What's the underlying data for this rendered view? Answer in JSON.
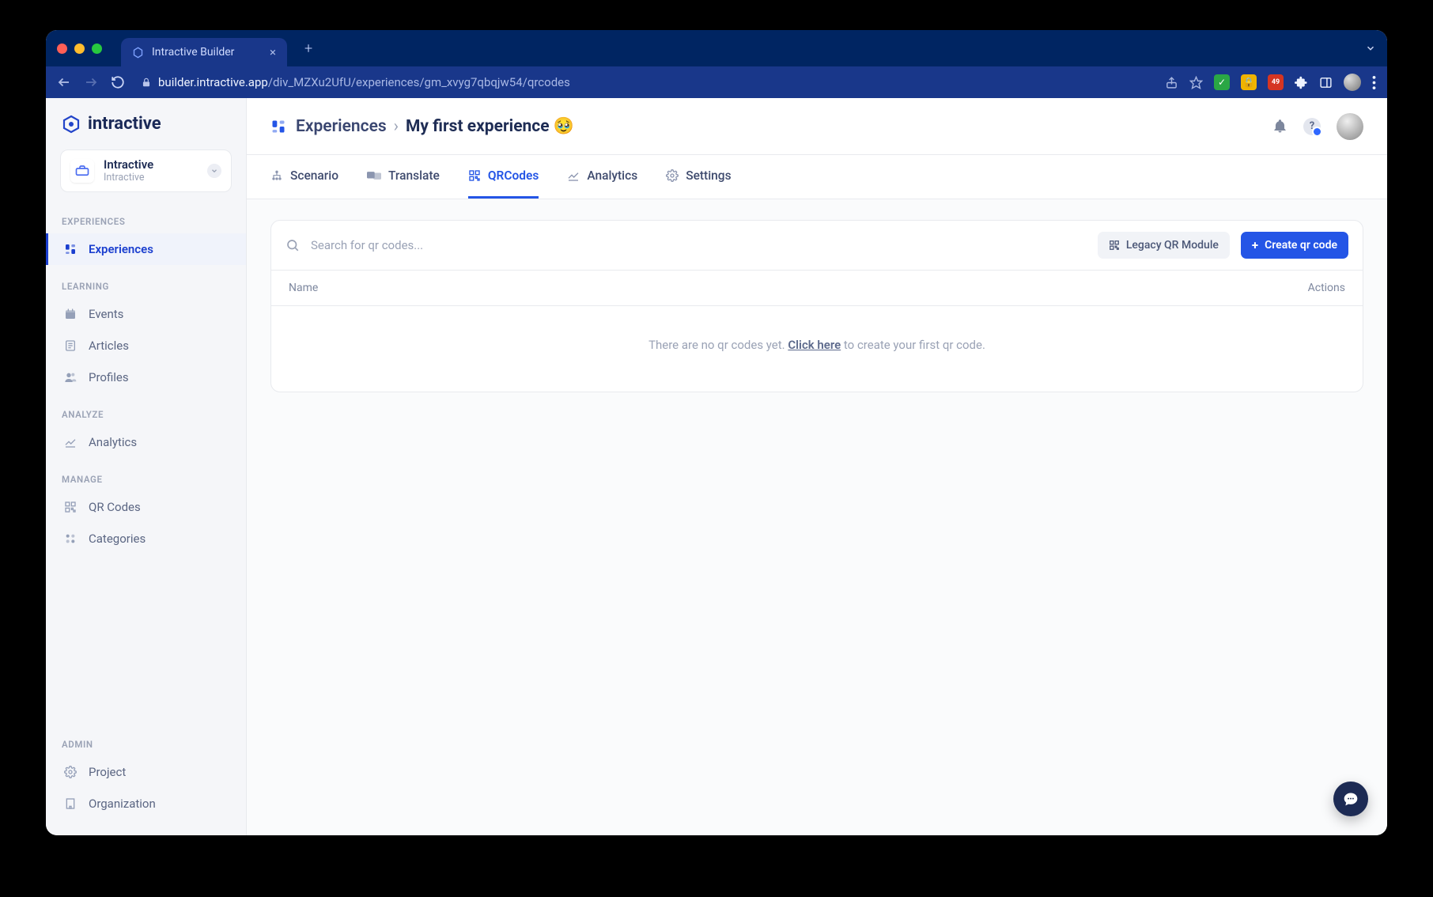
{
  "browser": {
    "tab_title": "Intractive Builder",
    "url_host": "builder.intractive.app",
    "url_path": "/div_MZXu2UfU/experiences/gm_xvyg7qbqjw54/qrcodes"
  },
  "logo_text": "intractive",
  "org": {
    "name": "Intractive",
    "sub": "Intractive"
  },
  "nav": {
    "sections": [
      {
        "title": "EXPERIENCES",
        "items": [
          {
            "label": "Experiences",
            "active": true,
            "icon": "widgets"
          }
        ]
      },
      {
        "title": "LEARNING",
        "items": [
          {
            "label": "Events",
            "icon": "calendar"
          },
          {
            "label": "Articles",
            "icon": "article"
          },
          {
            "label": "Profiles",
            "icon": "profiles"
          }
        ]
      },
      {
        "title": "ANALYZE",
        "items": [
          {
            "label": "Analytics",
            "icon": "chart"
          }
        ]
      },
      {
        "title": "MANAGE",
        "items": [
          {
            "label": "QR Codes",
            "icon": "qr"
          },
          {
            "label": "Categories",
            "icon": "categories"
          }
        ]
      },
      {
        "title": "ADMIN",
        "items": [
          {
            "label": "Project",
            "icon": "gear"
          },
          {
            "label": "Organization",
            "icon": "building"
          }
        ]
      }
    ]
  },
  "breadcrumb": {
    "root": "Experiences",
    "current": "My first experience 🥹"
  },
  "tabs": [
    {
      "label": "Scenario",
      "icon": "tree"
    },
    {
      "label": "Translate",
      "icon": "translate"
    },
    {
      "label": "QRCodes",
      "icon": "qr",
      "active": true
    },
    {
      "label": "Analytics",
      "icon": "chart"
    },
    {
      "label": "Settings",
      "icon": "gear"
    }
  ],
  "toolbar": {
    "search_placeholder": "Search for qr codes...",
    "legacy_btn": "Legacy QR Module",
    "create_btn": "Create qr code"
  },
  "table": {
    "col_name": "Name",
    "col_actions": "Actions",
    "empty_pre": "There are no qr codes yet. ",
    "empty_link": "Click here",
    "empty_post": " to create your first qr code."
  }
}
